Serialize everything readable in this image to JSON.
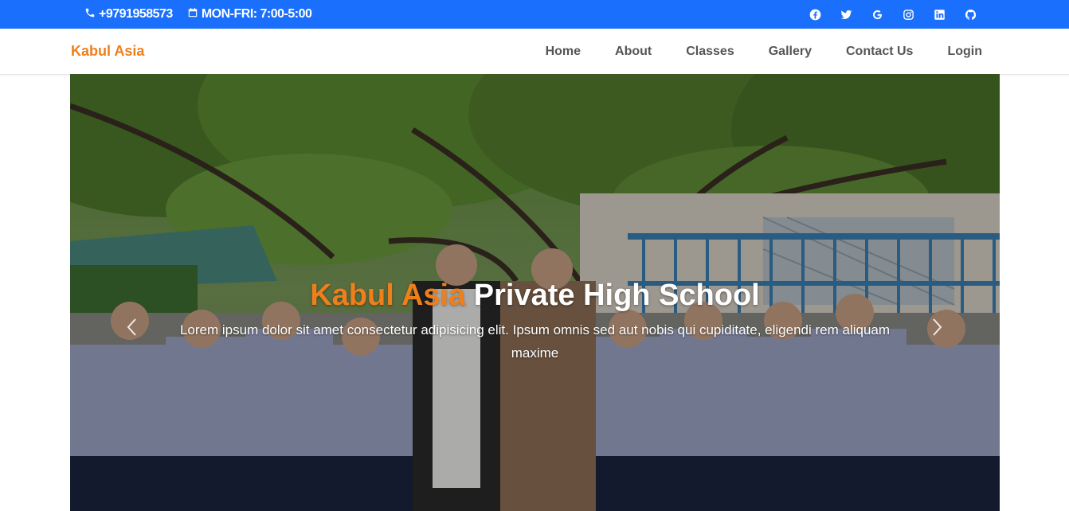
{
  "topbar": {
    "phone": "+9791958573",
    "hours": "MON-FRI: 7:00-5:00",
    "socials": [
      "facebook-icon",
      "twitter-icon",
      "google-icon",
      "instagram-icon",
      "linkedin-icon",
      "github-icon"
    ]
  },
  "nav": {
    "brand": "Kabul Asia",
    "items": [
      "Home",
      "About",
      "Classes",
      "Gallery",
      "Contact Us",
      "Login"
    ]
  },
  "hero": {
    "title_accent": "Kabul Asia",
    "title_rest": " Private High School",
    "subtitle": "Lorem ipsum dolor sit amet consectetur adipisicing elit. Ipsum omnis sed aut nobis qui cupiditate, eligendi rem aliquam maxime"
  },
  "colors": {
    "topbar_bg": "#1a6ffd",
    "brand": "#ef7f1a",
    "nav_text": "#555555"
  }
}
